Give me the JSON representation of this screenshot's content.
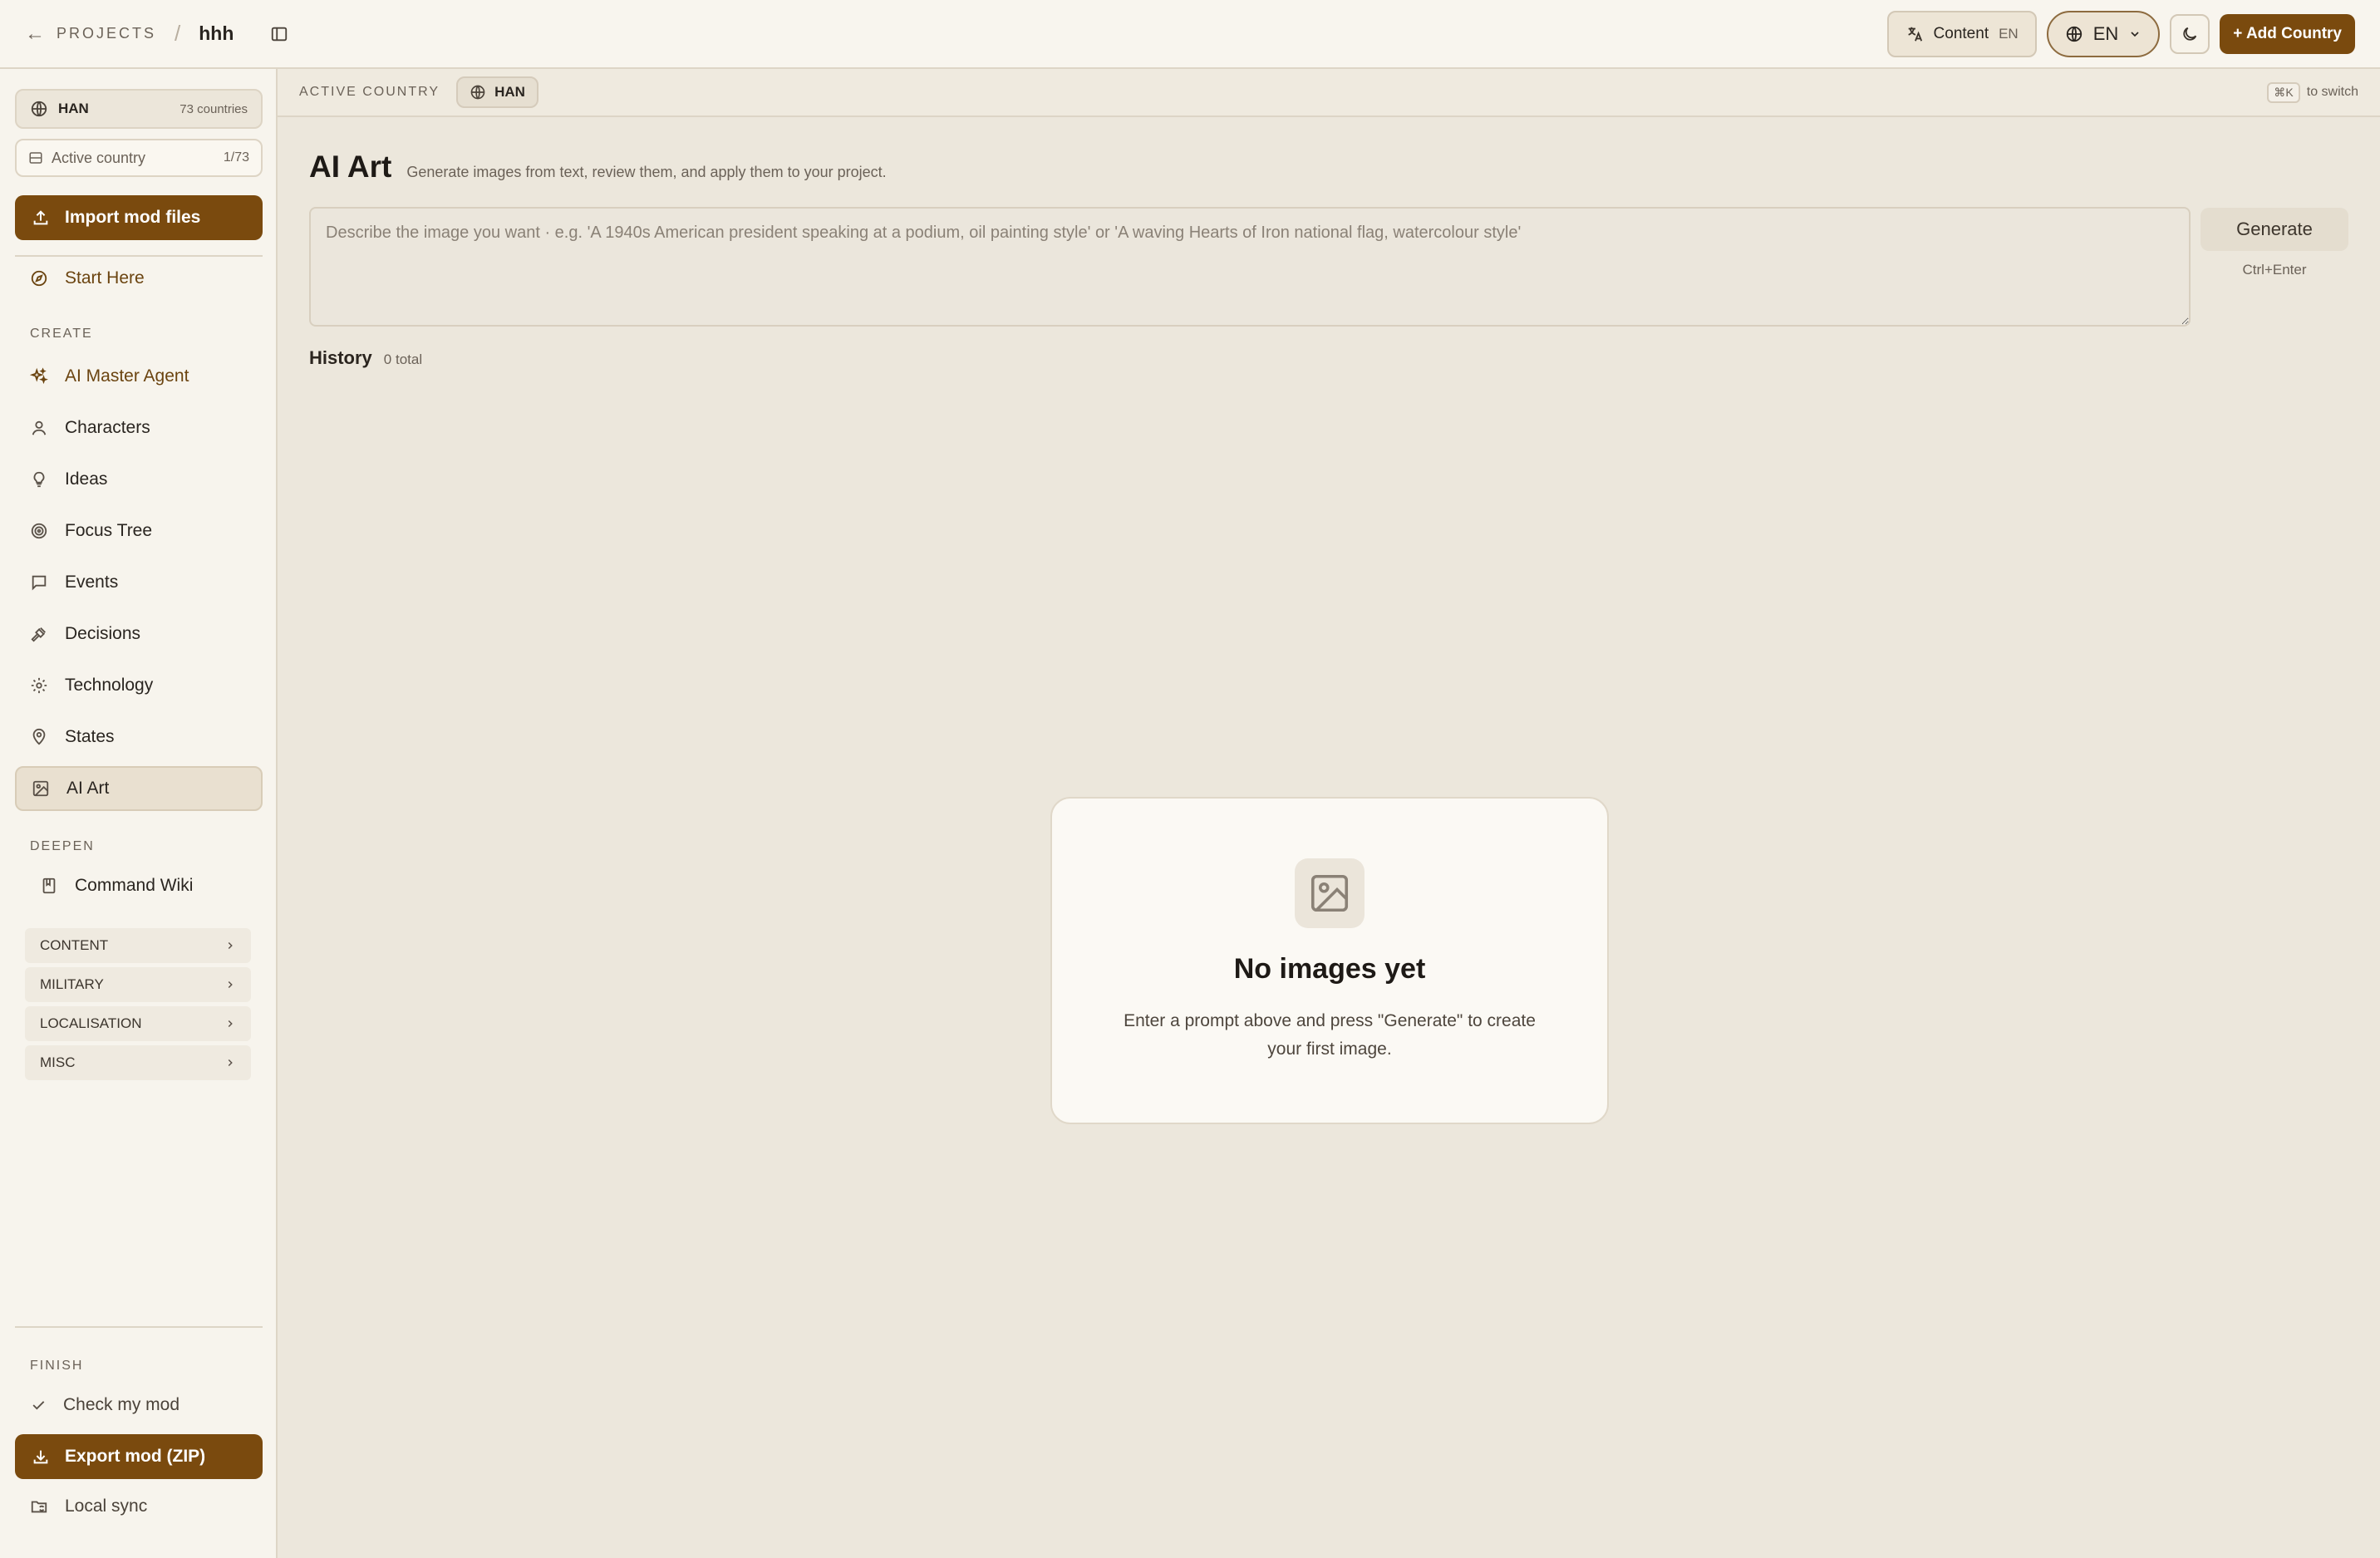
{
  "topbar": {
    "projects_label": "PROJECTS",
    "project_name": "hhh",
    "content_label": "Content",
    "content_lang": "EN",
    "lang_selector": "EN",
    "add_country_label": "+ Add Country"
  },
  "sidebar": {
    "country_tag": "HAN",
    "country_count": "73 countries",
    "active_country_label": "Active country",
    "active_country_fraction": "1/73",
    "import_label": "Import mod files",
    "start_here": "Start Here",
    "create_section": "CREATE",
    "create_items": [
      {
        "label": "AI Master Agent",
        "icon": "sparkles-icon"
      },
      {
        "label": "Characters",
        "icon": "user-icon"
      },
      {
        "label": "Ideas",
        "icon": "lightbulb-icon"
      },
      {
        "label": "Focus Tree",
        "icon": "target-icon"
      },
      {
        "label": "Events",
        "icon": "message-icon"
      },
      {
        "label": "Decisions",
        "icon": "gavel-icon"
      },
      {
        "label": "Technology",
        "icon": "gear-icon"
      },
      {
        "label": "States",
        "icon": "map-pin-icon"
      },
      {
        "label": "AI Art",
        "icon": "image-icon"
      }
    ],
    "deepen_section": "DEEPEN",
    "command_wiki": "Command Wiki",
    "groups": [
      "CONTENT",
      "MILITARY",
      "LOCALISATION",
      "MISC"
    ],
    "finish_section": "FINISH",
    "check_mod": "Check my mod",
    "export_label": "Export mod (ZIP)",
    "local_sync": "Local sync"
  },
  "country_bar": {
    "label": "ACTIVE COUNTRY",
    "tag": "HAN",
    "shortcut": "⌘K",
    "hint": "to switch"
  },
  "main": {
    "title": "AI Art",
    "description": "Generate images from text, review them, and apply them to your project.",
    "prompt_placeholder": "Describe the image you want · e.g. 'A 1940s American president speaking at a podium, oil painting style' or 'A waving Hearts of Iron national flag, watercolour style'",
    "prompt_value": "",
    "generate_label": "Generate",
    "generate_shortcut": "Ctrl+Enter",
    "history_label": "History",
    "history_count": "0 total",
    "empty_title": "No images yet",
    "empty_text": "Enter a prompt above and press \"Generate\" to create your first image."
  },
  "colors": {
    "brand": "#7a4a0e",
    "page_bg": "#ece7dc",
    "sidebar_bg": "#f7f4ed"
  }
}
